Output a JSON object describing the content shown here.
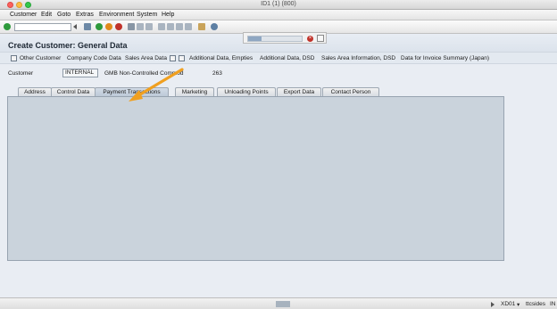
{
  "window": {
    "title": "ID1 (1) (800)"
  },
  "menu": {
    "items": [
      "Customer",
      "Edit",
      "Goto",
      "Extras",
      "Environment",
      "System",
      "Help"
    ]
  },
  "toolbar": {
    "okcode_value": ""
  },
  "page": {
    "title": "Create Customer: General Data"
  },
  "app_toolbar": {
    "items": [
      "Other Customer",
      "Company Code Data",
      "Sales Area Data",
      "Additional Data, Empties",
      "Additional Data, DSD",
      "Sales Area Information, DSD",
      "Data for Invoice Summary (Japan)"
    ]
  },
  "customer": {
    "label": "Customer",
    "value": "INTERNAL",
    "name": "GMB Non-Controlled Commod",
    "number": "263"
  },
  "tabs": [
    "Address",
    "Control Data",
    "Payment Transactions",
    "Marketing",
    "Unloading Points",
    "Export Data",
    "Contact Person"
  ],
  "active_tab": "Payment Transactions",
  "status": {
    "transaction": "XD01",
    "server": "ttcsides",
    "mode": "IN"
  },
  "colors": {
    "accent_arrow": "#f0a020",
    "panel": "#cad3dc"
  }
}
